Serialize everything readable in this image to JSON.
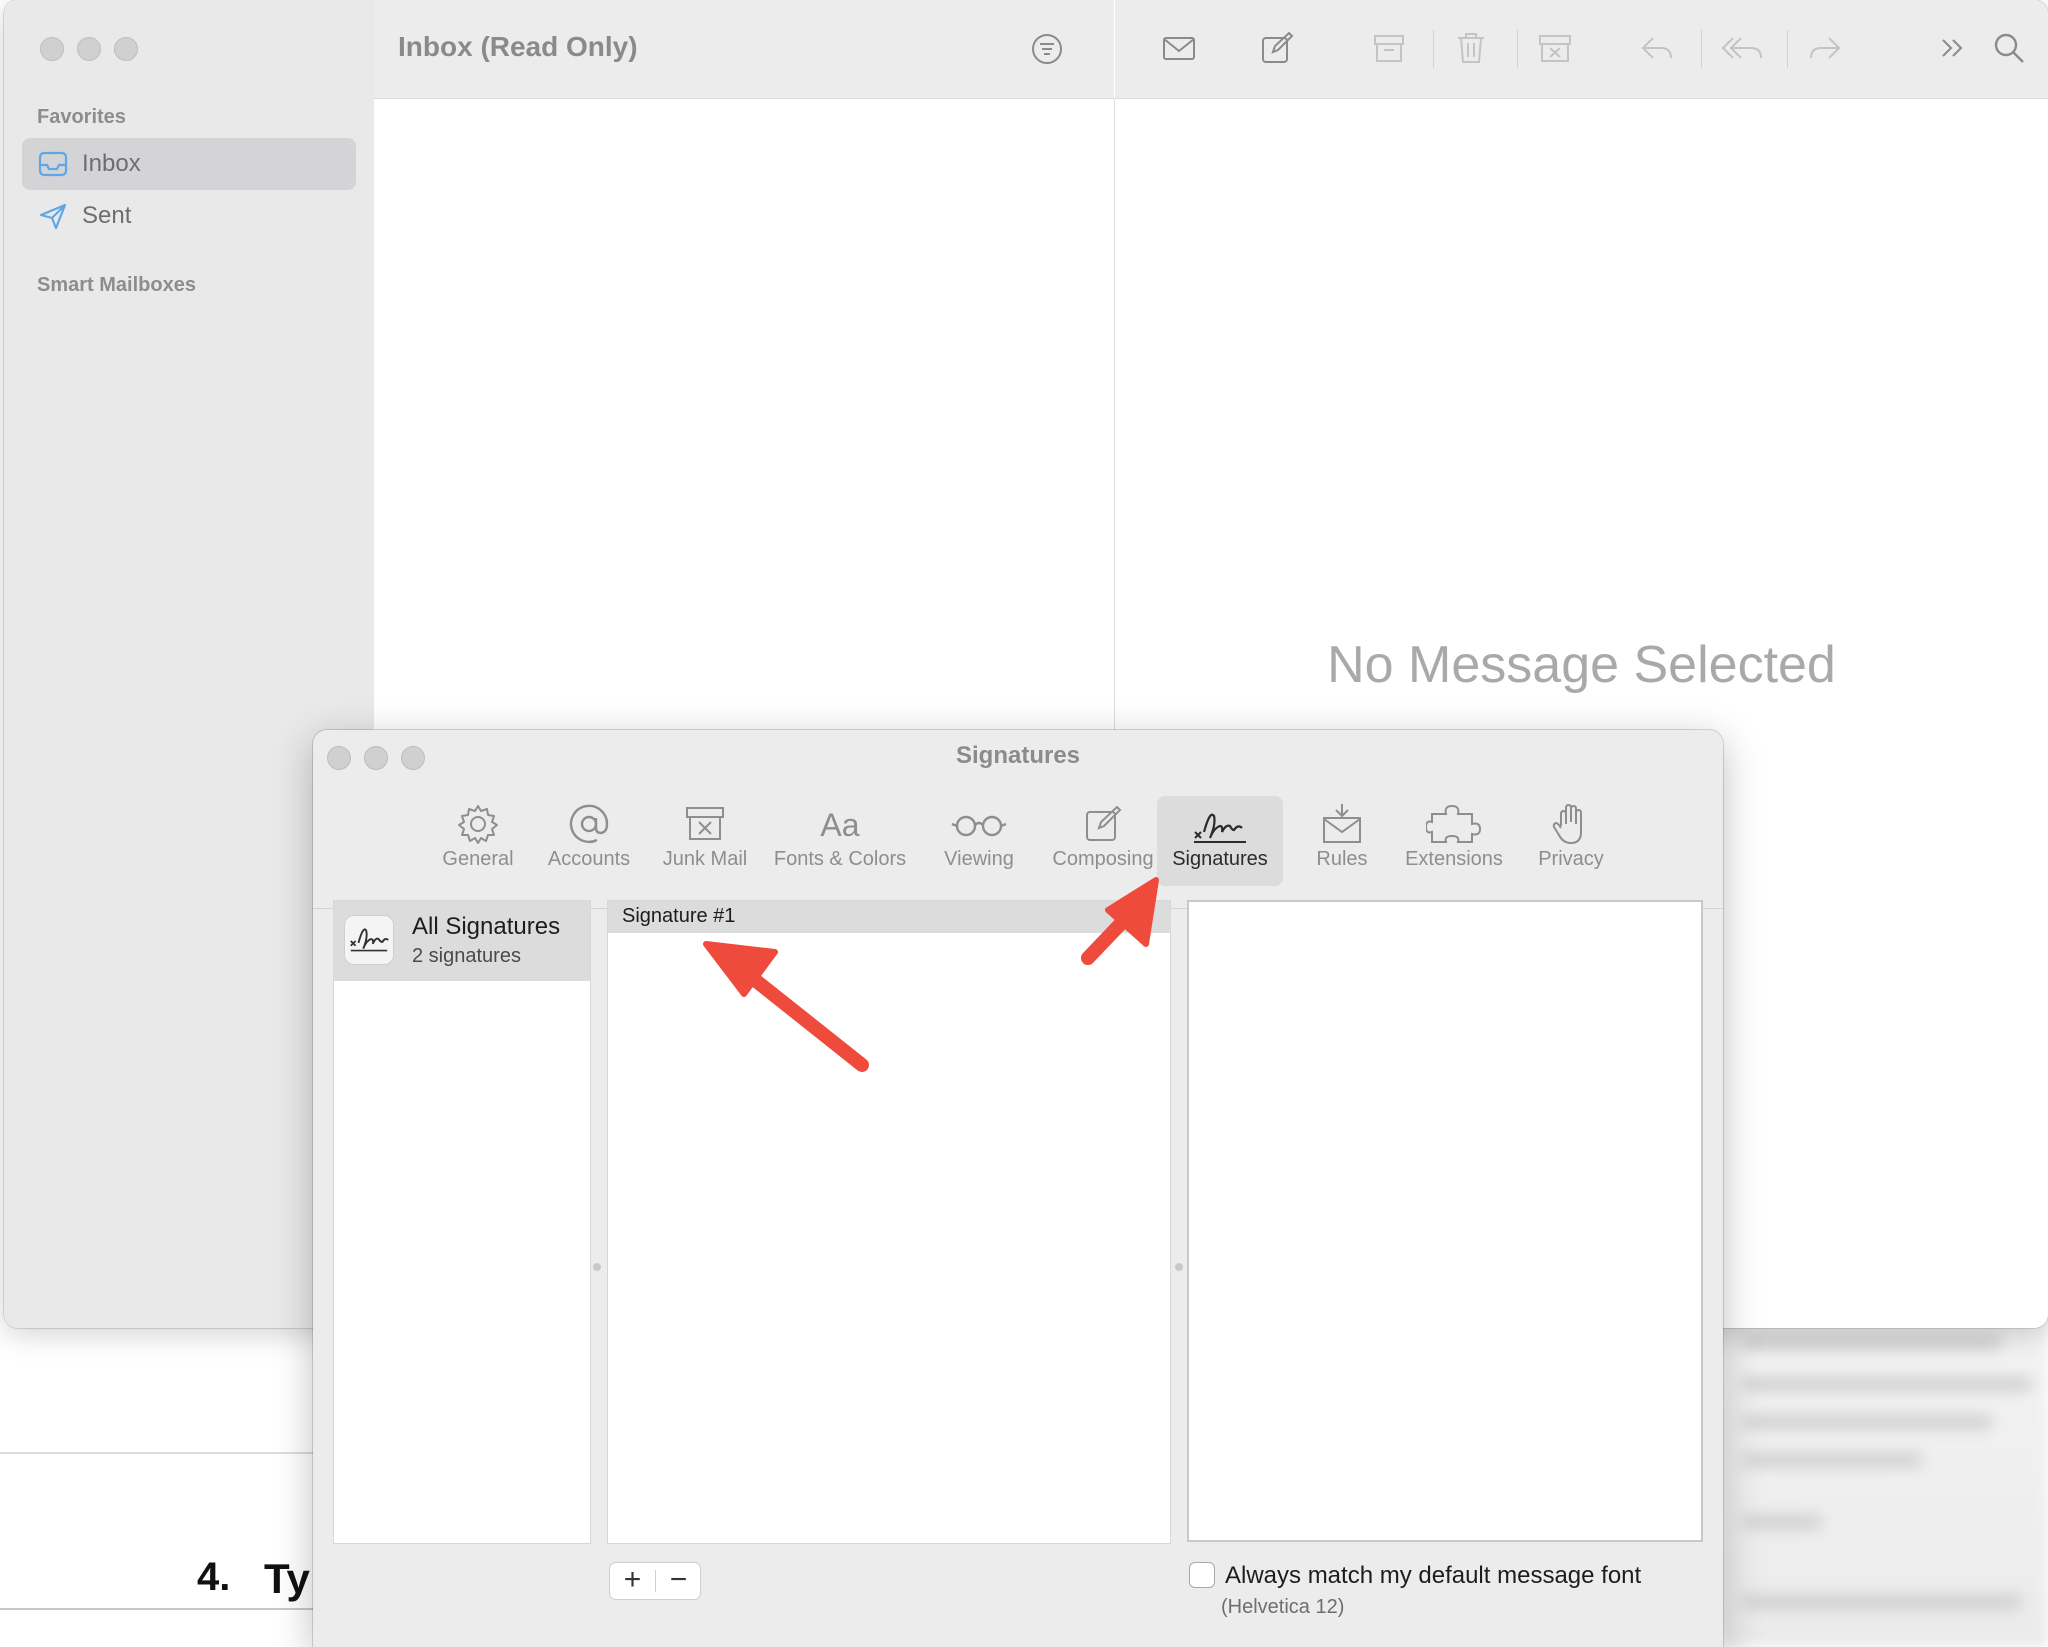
{
  "mail": {
    "favorites_label": "Favorites",
    "sidebar_items": [
      {
        "label": "Inbox",
        "icon": "inbox-icon"
      },
      {
        "label": "Sent",
        "icon": "paper-plane-icon"
      }
    ],
    "smart_mailboxes_label": "Smart Mailboxes",
    "list_title": "Inbox (Read Only)",
    "no_message_text": "No Message Selected",
    "toolbar_icons": [
      "envelope-icon",
      "compose-icon",
      "archive-icon",
      "trash-icon",
      "junk-icon",
      "reply-icon",
      "reply-all-icon",
      "forward-icon",
      "more-chevron-icon",
      "search-icon"
    ]
  },
  "prefs": {
    "title": "Signatures",
    "tabs": [
      {
        "label": "General",
        "icon": "gear-icon"
      },
      {
        "label": "Accounts",
        "icon": "at-sign-icon"
      },
      {
        "label": "Junk Mail",
        "icon": "junk-mail-icon"
      },
      {
        "label": "Fonts & Colors",
        "icon": "fonts-icon"
      },
      {
        "label": "Viewing",
        "icon": "glasses-icon"
      },
      {
        "label": "Composing",
        "icon": "compose-icon"
      },
      {
        "label": "Signatures",
        "icon": "signature-icon",
        "selected": true
      },
      {
        "label": "Rules",
        "icon": "rules-icon"
      },
      {
        "label": "Extensions",
        "icon": "puzzle-icon"
      },
      {
        "label": "Privacy",
        "icon": "hand-icon"
      }
    ],
    "all_signatures": {
      "title": "All Signatures",
      "count": "2 signatures"
    },
    "signatures": [
      "Signature #1"
    ],
    "add_label": "+",
    "remove_label": "−",
    "match_font_label": "Always match my default message font",
    "match_font_sub": "(Helvetica 12)",
    "match_font_checked": false
  },
  "background_doc": {
    "heading_number": "4.",
    "heading_text": "Ty"
  },
  "colors": {
    "annotation_arrow": "#ef4b3c",
    "selection": "#dcdcdc"
  }
}
